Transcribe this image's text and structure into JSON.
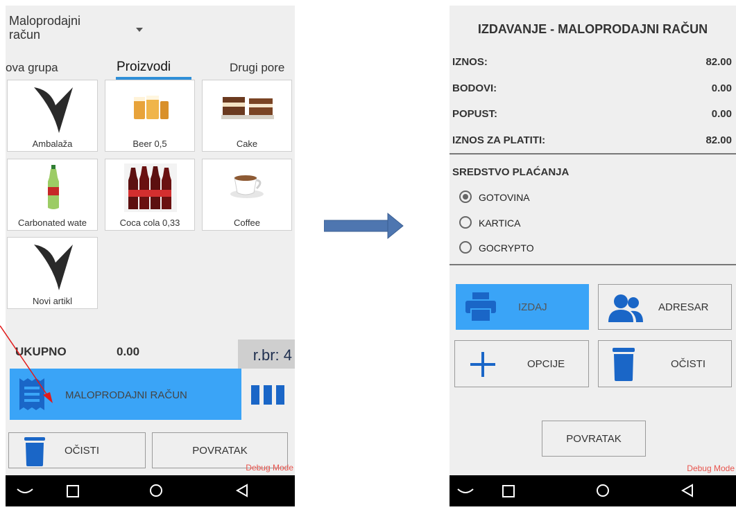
{
  "left_screen": {
    "doc_type": "Maloprodajni račun",
    "tabs": [
      {
        "label": "ova grupa"
      },
      {
        "label": "Proizvodi"
      },
      {
        "label": "Drugi pore"
      }
    ],
    "products": [
      {
        "label": "Ambalaža",
        "icon": "logo-icon"
      },
      {
        "label": "Beer 0,5",
        "icon": "beer-image"
      },
      {
        "label": "Cake",
        "icon": "cake-image"
      },
      {
        "label": "Carbonated wate",
        "icon": "bottle-image"
      },
      {
        "label": "Coca cola 0,33",
        "icon": "cola-image"
      },
      {
        "label": "Coffee",
        "icon": "coffee-image"
      },
      {
        "label": "Novi artikl",
        "icon": "logo-icon"
      }
    ],
    "total_label": "UKUPNO",
    "total_value": "0.00",
    "receipt_number": "r.br: 4",
    "primary_button": "MALOPRODAJNI RAČUN",
    "clear_button": "OČISTI",
    "back_button": "POVRATAK",
    "debug": "Debug Mode"
  },
  "right_screen": {
    "title": "IZDAVANJE - MALOPRODAJNI RAČUN",
    "rows": [
      {
        "label": "IZNOS:",
        "value": "82.00"
      },
      {
        "label": "BODOVI:",
        "value": "0.00"
      },
      {
        "label": "POPUST:",
        "value": "0.00"
      },
      {
        "label": "IZNOS ZA PLATITI:",
        "value": "82.00"
      }
    ],
    "payment_title": "SREDSTVO PLAĆANJA",
    "payment_options": [
      {
        "label": "GOTOVINA",
        "selected": true
      },
      {
        "label": "KARTICA",
        "selected": false
      },
      {
        "label": "GOCRYPTO",
        "selected": false
      }
    ],
    "buttons": {
      "issue": "IZDAJ",
      "address_book": "ADRESAR",
      "options": "OPCIJE",
      "clear": "OČISTI",
      "back": "POVRATAK"
    },
    "debug": "Debug Mode"
  },
  "colors": {
    "accent": "#3aa4f7",
    "icon_blue": "#1a66c7",
    "tab_underline": "#2f8fd8",
    "arrow": "#4e76b0",
    "debug": "#e8534c",
    "red_arrow": "#e11b1b"
  }
}
